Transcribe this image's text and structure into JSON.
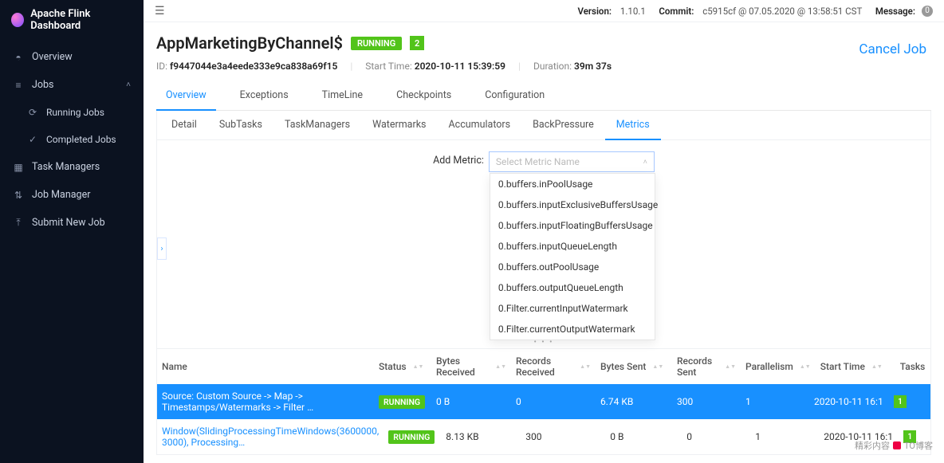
{
  "brand": "Apache Flink Dashboard",
  "topbar": {
    "version_label": "Version:",
    "version": "1.10.1",
    "commit_label": "Commit:",
    "commit": "c5915cf @ 07.05.2020 @ 13:58:51 CST",
    "message_label": "Message:",
    "message_badge": "0"
  },
  "sidebar": {
    "items": [
      {
        "icon": "◓",
        "label": "Overview"
      },
      {
        "icon": "≡",
        "label": "Jobs",
        "chev": "˄"
      },
      {
        "icon": "⟳",
        "label": "Running Jobs",
        "sub": true
      },
      {
        "icon": "✓",
        "label": "Completed Jobs",
        "sub": true
      },
      {
        "icon": "▦",
        "label": "Task Managers"
      },
      {
        "icon": "⇅",
        "label": "Job Manager"
      },
      {
        "icon": "⤒",
        "label": "Submit New Job"
      }
    ]
  },
  "header": {
    "title": "AppMarketingByChannel$",
    "status": "RUNNING",
    "count": "2",
    "cancel": "Cancel Job",
    "id_label": "ID:",
    "id": "f9447044e3a4eede333e9ca838a69f15",
    "start_label": "Start Time:",
    "start": "2020-10-11 15:39:59",
    "duration_label": "Duration:",
    "duration": "39m 37s"
  },
  "tabs": [
    "Overview",
    "Exceptions",
    "TimeLine",
    "Checkpoints",
    "Configuration"
  ],
  "activeTab": 0,
  "subtabs": [
    "Detail",
    "SubTasks",
    "TaskManagers",
    "Watermarks",
    "Accumulators",
    "BackPressure",
    "Metrics"
  ],
  "activeSubtab": 6,
  "metric": {
    "label": "Add Metric:",
    "placeholder": "Select Metric Name",
    "options": [
      "0.buffers.inPoolUsage",
      "0.buffers.inputExclusiveBuffersUsage",
      "0.buffers.inputFloatingBuffersUsage",
      "0.buffers.inputQueueLength",
      "0.buffers.outPoolUsage",
      "0.buffers.outputQueueLength",
      "0.Filter.currentInputWatermark",
      "0.Filter.currentOutputWatermark"
    ]
  },
  "table": {
    "columns": [
      "Name",
      "Status",
      "Bytes Received",
      "Records Received",
      "Bytes Sent",
      "Records Sent",
      "Parallelism",
      "Start Time",
      "Tasks"
    ],
    "rows": [
      {
        "name": "Source: Custom Source -> Map -> Timestamps/Watermarks -> Filter …",
        "status": "RUNNING",
        "bytesReceived": "0 B",
        "recordsReceived": "0",
        "bytesSent": "6.74 KB",
        "recordsSent": "300",
        "parallelism": "1",
        "startTime": "2020-10-11 16:1",
        "tasks": "1",
        "selected": true
      },
      {
        "name": "Window(SlidingProcessingTimeWindows(3600000, 3000), Processing…",
        "status": "RUNNING",
        "bytesReceived": "8.13 KB",
        "recordsReceived": "300",
        "bytesSent": "0 B",
        "recordsSent": "0",
        "parallelism": "1",
        "startTime": "2020-10-11 16:1",
        "tasks": "1",
        "selected": false
      }
    ]
  },
  "watermark": "精彩内容",
  "watermark_suffix": "TO博客"
}
